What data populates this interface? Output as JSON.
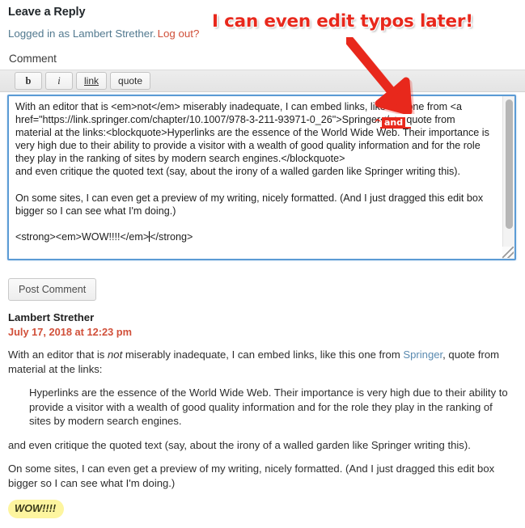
{
  "form": {
    "title": "Leave a Reply",
    "logged_in_text": "Logged in as Lambert Strether.",
    "logout_label": "Log out?",
    "comment_label": "Comment",
    "post_button_label": "Post Comment"
  },
  "toolbar": {
    "bold_label": "b",
    "italic_label": "i",
    "link_label": "link",
    "quote_label": "quote"
  },
  "editor": {
    "value_before_caret": "With an editor that is <em>not</em> miserably inadequate, I can embed links, like this one from <a href=\"https://link.springer.com/chapter/10.1007/978-3-211-93971-0_26\">Springer</a>, quote from material at the links:<blockquote>Hyperlinks are the essence of the World Wide Web. Their importance is very high due to their ability to provide a visitor with a wealth of good quality information and for the role they play in the ranking of sites by modern search engines.</blockquote>\nand even critique the quoted text (say, about the irony of a walled garden like Springer writing this).\n\nOn some sites, I can even get a preview of my writing, nicely formatted. (And I just dragged this edit box bigger so I can see what I'm doing.)\n\n<strong><em>WOW!!!!</em>",
    "value_after_caret": "</strong>"
  },
  "comment": {
    "author": "Lambert Strether",
    "date": "July 17, 2018 at 12:23 pm",
    "para1_before_link": "With an editor that is ",
    "para1_italic": "not",
    "para1_mid": " miserably inadequate, I can embed links, like this one from ",
    "para1_link": "Springer",
    "para1_after_link": ", quote from material at the links:",
    "blockquote": "Hyperlinks are the essence of the World Wide Web. Their importance is very high due to their ability to provide a visitor with a wealth of good quality information and for the role they play in the ranking of sites by modern search engines.",
    "para2": "and even critique the quoted text (say, about the irony of a walled garden like Springer writing this).",
    "para3": "On some sites, I can even get a preview of my writing, nicely formatted. (And I just dragged this edit box bigger so I can see what I'm doing.)",
    "para4_highlight": "WOW!!!!"
  },
  "annotations": {
    "headline": "I can even edit typos later!",
    "insert_word": "and",
    "caret_mark": "^",
    "color": "#e8281c"
  }
}
